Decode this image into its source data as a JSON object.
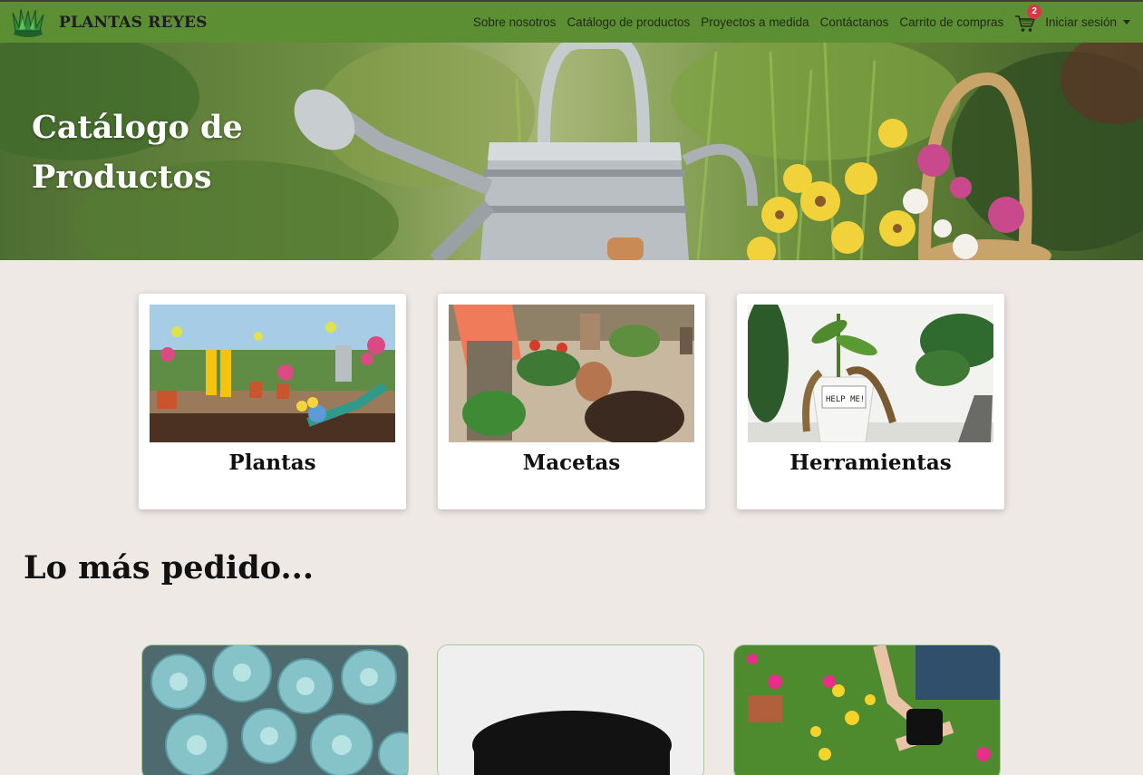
{
  "brand": {
    "name": "PLANTAS REYES",
    "logo_icon": "grass-logo-icon"
  },
  "nav": {
    "links": [
      "Sobre nosotros",
      "Catálogo de productos",
      "Proyectos a medida",
      "Contáctanos",
      "Carrito de compras"
    ],
    "cart_icon": "shopping-cart-icon",
    "cart_count": "2",
    "login_label": "Iniciar sesión"
  },
  "hero": {
    "title": "Catálogo de Productos"
  },
  "categories": [
    {
      "label": "Plantas"
    },
    {
      "label": "Macetas"
    },
    {
      "label": "Herramientas"
    }
  ],
  "popular": {
    "title": "Lo más pedido..."
  },
  "colors": {
    "navbar": "#5c8f33",
    "background": "#efe9e6",
    "badge": "#dc3545"
  }
}
